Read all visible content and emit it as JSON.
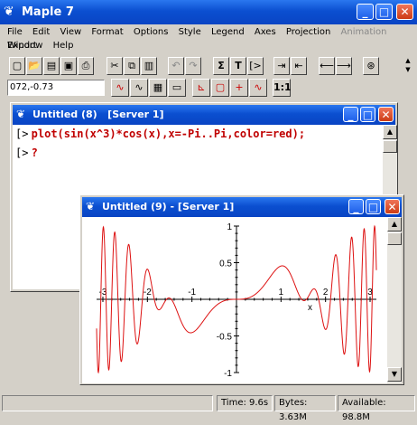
{
  "app": {
    "title": "Maple 7"
  },
  "menu": [
    "File",
    "Edit",
    "View",
    "Format",
    "Options",
    "Style",
    "Legend",
    "Axes",
    "Projection",
    "Animation",
    "Export",
    "Window",
    "Help"
  ],
  "coord": {
    "value": "072,-0.73"
  },
  "toolbar": {
    "row1": [
      "new",
      "open",
      "save-all",
      "save",
      "print",
      "cut",
      "copy",
      "paste",
      "undo",
      "redo",
      "sigma",
      "T",
      "exec-group",
      "indent",
      "outdent",
      "back",
      "forward",
      "stop"
    ],
    "row2": [
      "line",
      "spline",
      "patch",
      "patch-no-grid",
      "frame-axes",
      "box-axes",
      "normal-axes",
      "no-axes",
      "constrained"
    ],
    "constrained_label": "1:1"
  },
  "worksheet": {
    "title": "Untitled (8)   [Server 1]",
    "prompt": "[>",
    "command": "plot(sin(x^3)*cos(x),x=-Pi..Pi,color=red);",
    "second_prompt": "[>",
    "second_text": "?"
  },
  "plotwin": {
    "title": "Untitled (9) - [Server 1]"
  },
  "status": {
    "time": "Time:  9.6s",
    "bytes": "Bytes: 3.63M",
    "available": "Available: 98.8M"
  },
  "colors": {
    "accent": "#0b4fd0",
    "command": "#c00000",
    "curve": "#dd1111"
  },
  "chart_data": {
    "type": "line",
    "function": "sin(x^3)*cos(x)",
    "xlim": [
      -3.1416,
      3.1416
    ],
    "ylim": [
      -1,
      1
    ],
    "x_ticks": [
      "-3",
      "-2",
      "-1",
      "1",
      "2",
      "3"
    ],
    "y_ticks": [
      "1",
      "0.5",
      "-0.5",
      "-1"
    ],
    "xlabel": "x",
    "color": "#dd1111"
  }
}
